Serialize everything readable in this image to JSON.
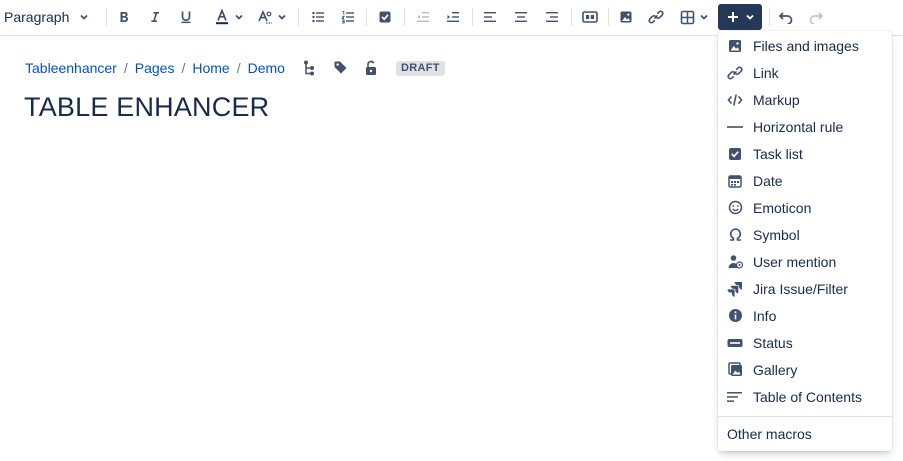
{
  "toolbar": {
    "paragraph_label": "Paragraph",
    "buttons": [
      "bold",
      "italic",
      "underline",
      "text-color",
      "text-formatting",
      "bullet-list",
      "numbered-list",
      "task",
      "outdent",
      "indent",
      "align-left",
      "align-center",
      "align-right",
      "layout",
      "image",
      "link",
      "table",
      "insert",
      "undo",
      "redo"
    ]
  },
  "breadcrumb": {
    "items": [
      "Tableenhancer",
      "Pages",
      "Home",
      "Demo"
    ],
    "separator": "/",
    "status": "DRAFT"
  },
  "page": {
    "title": "TABLE ENHANCER"
  },
  "insert_menu": {
    "items": [
      {
        "label": "Files and images",
        "icon": "image-icon"
      },
      {
        "label": "Link",
        "icon": "link-icon"
      },
      {
        "label": "Markup",
        "icon": "code-icon"
      },
      {
        "label": "Horizontal rule",
        "icon": "horizontal-rule-icon"
      },
      {
        "label": "Task list",
        "icon": "checkbox-icon"
      },
      {
        "label": "Date",
        "icon": "calendar-icon"
      },
      {
        "label": "Emoticon",
        "icon": "emoji-icon"
      },
      {
        "label": "Symbol",
        "icon": "omega-icon"
      },
      {
        "label": "User mention",
        "icon": "user-icon"
      },
      {
        "label": "Jira Issue/Filter",
        "icon": "jira-icon"
      },
      {
        "label": "Info",
        "icon": "info-icon"
      },
      {
        "label": "Status",
        "icon": "status-icon"
      },
      {
        "label": "Gallery",
        "icon": "gallery-icon"
      },
      {
        "label": "Table of Contents",
        "icon": "toc-icon"
      }
    ],
    "other_label": "Other macros"
  },
  "colors": {
    "accent": "#0052cc",
    "insert_button_bg": "#253858",
    "text": "#172b4d",
    "icon": "#42526e"
  }
}
